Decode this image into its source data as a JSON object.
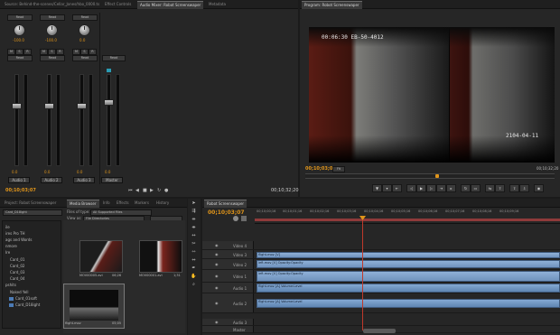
{
  "colors": {
    "accent_orange": "#e0951a",
    "playhead_red": "#c0392b",
    "clip_blue": "#7ea2cb",
    "panel_bg": "#262626",
    "workarea_red": "#8e3a3a"
  },
  "left_panel": {
    "tabs": [
      "Source: Behind-the-scenes/Cellar_Jones/hbo_0000.ts",
      "Effect Controls",
      "Audio Mixer: Robot Screenswaper",
      "Metadata"
    ],
    "active_tab_index": 2,
    "channels": [
      {
        "label": "Audio 1",
        "mode": "Read",
        "pan_value": "-100.0",
        "level": "0.0"
      },
      {
        "label": "Audio 2",
        "mode": "Read",
        "pan_value": "-100.0",
        "level": "0.0"
      },
      {
        "label": "Audio 3",
        "mode": "Read",
        "pan_value": "0.0",
        "level": "0.0"
      },
      {
        "label": "Master",
        "mode": "Read",
        "pan_value": "",
        "level": "0.0"
      }
    ],
    "timecode_left": "00;10;03;07",
    "timecode_right": "00;10;32;20"
  },
  "program_monitor": {
    "tab_label": "Program: Robot Screenswaper",
    "overlay_text_top": "00:06:30 EB-50-4012",
    "overlay_text_bottom": "2104-04-11",
    "timecode": "00;10;03;07",
    "zoom": "Fit",
    "duration": "00;10;32;20",
    "transport_icons": [
      "mark-in",
      "mark-out",
      "go-to-in",
      "step-back",
      "play-stop",
      "step-forward",
      "go-to-out",
      "shuttle",
      "loop",
      "safe-margins",
      "trim",
      "export-frame"
    ]
  },
  "project_panel": {
    "tabs": [
      "Project: Robot Screenswaper",
      "Media Browser",
      "Info",
      "Effects",
      "Markers",
      "History"
    ],
    "active_tab_index": 1,
    "drive_dropdown": "Card_D18ight",
    "files_of_type_label": "Files of type:",
    "files_of_type_value": "All Supported Files",
    "view_as_label": "View as:",
    "view_as_value": "File Directories",
    "folders": [
      "ile",
      "ires Pro TH",
      "ags and Words",
      "nmore",
      "Ire",
      "Card_01",
      "Card_02",
      "Card_03",
      "Card_04",
      "pshits",
      "Naked Yell",
      "Card_01soft",
      "Card_D18ight"
    ],
    "thumbnails": [
      {
        "name": "MOV00005.avi",
        "duration": "06;26"
      },
      {
        "name": "MOV00001.avi",
        "duration": "1;31"
      },
      {
        "name": "flight.mov",
        "duration": "05;05"
      }
    ]
  },
  "tools": [
    "selection-tool",
    "track-select-tool",
    "ripple-edit-tool",
    "rolling-edit-tool",
    "rate-stretch-tool",
    "razor-tool",
    "slip-tool",
    "slide-tool",
    "pen-tool",
    "hand-tool",
    "zoom-tool"
  ],
  "timeline": {
    "tab_label": "Robot Screenswaper",
    "timecode": "00;10;03;07",
    "ruler_ticks": [
      "00;10;00;16",
      "00;10;01;16",
      "00;10;02;16",
      "00;10;03;16",
      "00;10;04;16",
      "00;10;05;16",
      "00;10;06;16",
      "00;10;07;16",
      "00;10;08;16",
      "00;10;09;16"
    ],
    "tracks": [
      {
        "name": "Video 4",
        "kind": "video"
      },
      {
        "name": "Video 3",
        "kind": "video"
      },
      {
        "name": "Video 2",
        "kind": "video"
      },
      {
        "name": "Video 1",
        "kind": "video"
      },
      {
        "name": "Audio 1",
        "kind": "audio"
      },
      {
        "name": "Audio 2",
        "kind": "audio"
      },
      {
        "name": "Audio 3",
        "kind": "audio"
      },
      {
        "name": "Master",
        "kind": "audio"
      }
    ],
    "clips": {
      "video3": "flight.mov [V]",
      "video2": "left.mov [V] Opacity:Opacity",
      "video1": "left.mov [V] Opacity:Opacity",
      "audio1": "flight.mov [A] Volume:Level",
      "audio2": "flight.mov [A] Volume:Level"
    }
  }
}
